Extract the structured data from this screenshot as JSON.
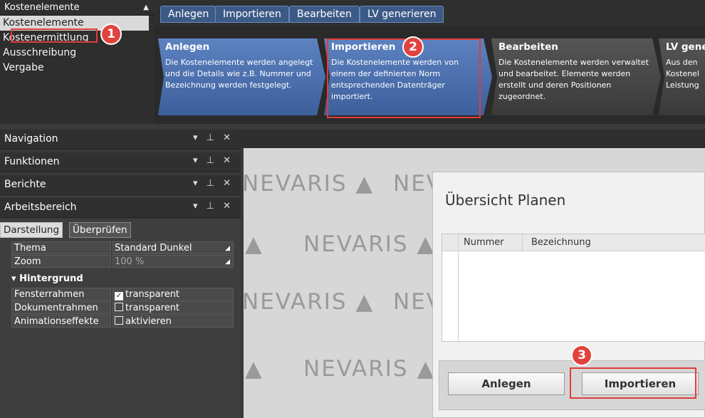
{
  "left_title": "Kostenelemente",
  "nav_items": [
    "Kostenelemente",
    "Kostenermittlung",
    "Ausschreibung",
    "Vergabe"
  ],
  "tabs": [
    "Anlegen",
    "Importieren",
    "Bearbeiten",
    "LV generieren"
  ],
  "ribbon": [
    {
      "title": "Anlegen",
      "desc": "Die Kostenelemente werden angelegt und die Details wie z.B. Nummer und Bezeichnung werden festgelegt."
    },
    {
      "title": "Importieren",
      "desc": "Die Kostenelemente werden von einem der definierten Norm entsprechenden Datenträger importiert."
    },
    {
      "title": "Bearbeiten",
      "desc": "Die Kostenelemente werden verwaltet und bearbeitet. Elemente werden erstellt und deren Positionen zugeordnet."
    },
    {
      "title": "LV gene",
      "desc": "Aus den Kostenel Leistung"
    }
  ],
  "panels": [
    "Navigation",
    "Funktionen",
    "Berichte",
    "Arbeitsbereich"
  ],
  "panel_ctrls": "▾ ⊥ ✕",
  "subtabs": [
    "Darstellung",
    "Überprüfen"
  ],
  "props": {
    "thema_k": "Thema",
    "thema_v": "Standard Dunkel",
    "zoom_k": "Zoom",
    "zoom_v": "100 %",
    "section": "Hintergrund",
    "fenster_k": "Fensterrahmen",
    "fenster_v": "transparent",
    "dokument_k": "Dokumentrahmen",
    "dokument_v": "transparent",
    "anim_k": "Animationseffekte",
    "anim_v": "aktivieren"
  },
  "watermark": "NEVARIS",
  "dialog": {
    "title": "Übersicht Planen",
    "col1": "Nummer",
    "col2": "Bezeichnung",
    "btn_anlegen": "Anlegen",
    "btn_importieren": "Importieren"
  },
  "badges": [
    "1",
    "2",
    "3"
  ],
  "colors": {
    "highlight": "#e23b3b",
    "ribbon_blue": "#4a6fae"
  }
}
